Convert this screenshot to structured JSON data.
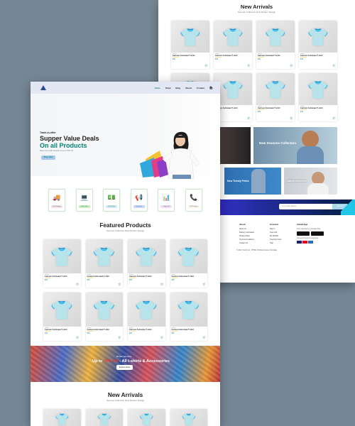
{
  "front": {
    "nav": {
      "items": [
        "Home",
        "Shop",
        "Blog",
        "About",
        "Contact"
      ],
      "active_index": 0,
      "cart_icon": "bag-icon"
    },
    "hero": {
      "tagline": "Trade-in-offer",
      "headline": "Supper Value Deals",
      "headline_accent": "On all Products",
      "note": "Save more with coupons & up to 70% off",
      "button": "Shop Now"
    },
    "features": [
      {
        "label": "Free Shipping",
        "icon": "truck-icon",
        "color": "#fddde4"
      },
      {
        "label": "Online Order",
        "icon": "laptop-icon",
        "color": "#cdebbc"
      },
      {
        "label": "Save Money",
        "icon": "money-icon",
        "color": "#d1e8f2"
      },
      {
        "label": "Promotions",
        "icon": "megaphone-icon",
        "color": "#cdd4f8"
      },
      {
        "label": "Happy Sell",
        "icon": "chart-icon",
        "color": "#f6dbf6"
      },
      {
        "label": "F24/7 Support",
        "icon": "phone-icon",
        "color": "#fff2e5"
      }
    ],
    "featured": {
      "title": "Featured Products",
      "subtitle": "Summer Collection New Modern Design",
      "product_brand": "adidas",
      "product_name": "Cartoon Astronaut T-shirt",
      "product_price": "$78",
      "product_stars": "★★★★★",
      "count": 8
    },
    "banner": {
      "subtitle": "Repair Services",
      "title_prefix": "Up to ",
      "title_highlight": "70% Off",
      "title_suffix": " - All t-shirts & Accessories",
      "button": "Explore More"
    },
    "new_arrivals": {
      "title": "New Arrivals",
      "subtitle": "Summer Collection New Modern Design",
      "count": 4
    }
  },
  "back": {
    "new_arrivals": {
      "title": "New Arrivals",
      "subtitle": "Summer Collection New Modern Design",
      "count": 8
    },
    "promo": {
      "big_title": "New Seasons Collection",
      "small_title_1": "New Trendy Prints",
      "small_title_2": "Latest collection"
    },
    "newsletter": {
      "input_placeholder": "Your email address",
      "button": "Sign Up"
    },
    "footer": {
      "about_title": "About",
      "about_items": [
        "About Us",
        "Delivery Information",
        "Privacy Policy",
        "Terms & Conditions",
        "Contact Us"
      ],
      "account_title": "Account",
      "account_items": [
        "Sign In",
        "View Cart",
        "My Wishlist",
        "Track My Order",
        "Help"
      ],
      "app_title": "Install App",
      "app_note": "From App Store or Google Play",
      "secured": "Secured Payment Gateways",
      "copyright": "© 2021, Tech2 etc - HTML CSS Ecommerce Template"
    }
  },
  "colors": {
    "accent": "#088178",
    "header_bg": "#e3e6f3",
    "page_bg": "#758796",
    "newsletter_bg": "#041e42"
  }
}
